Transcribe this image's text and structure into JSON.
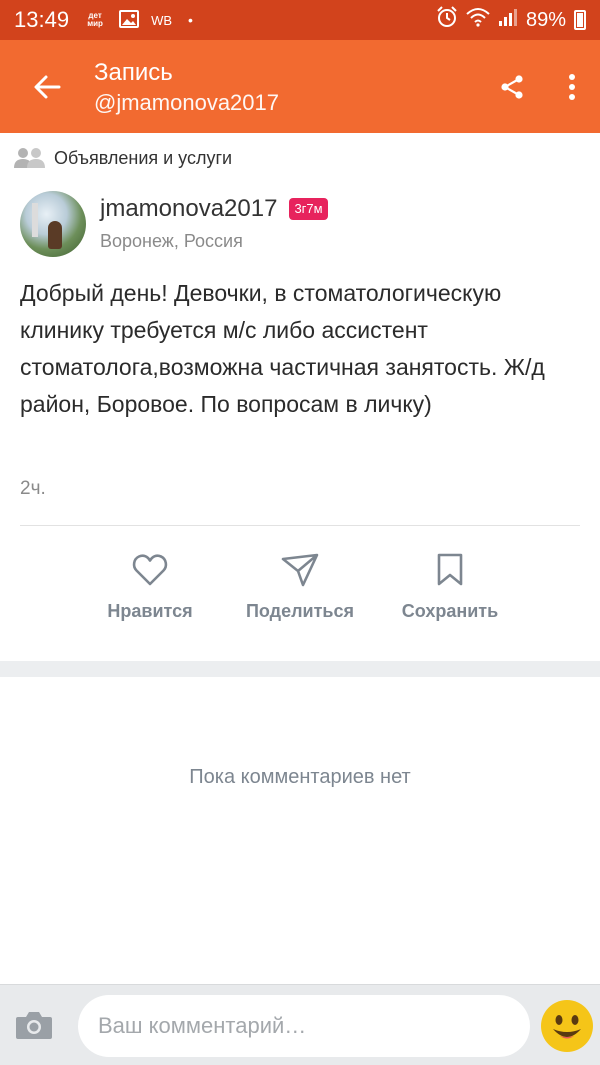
{
  "status_bar": {
    "time": "13:49",
    "notif_detmir": "дет мир",
    "notif_wb": "WB",
    "notif_dot": "•",
    "battery": "89%"
  },
  "app_bar": {
    "title": "Запись",
    "subtitle": "@jmamonova2017"
  },
  "post": {
    "category": "Объявления и услуги",
    "author": {
      "name": "jmamonova2017",
      "age_badge": "3г7м",
      "location": "Воронеж, Россия"
    },
    "text": "Добрый день! Девочки, в стоматологическую клинику требуется м/с либо ассистент стоматолога,возможна частичная занятость. Ж/д район, Боровое. По вопросам в личку)",
    "time": "2ч.",
    "actions": {
      "like": "Нравится",
      "share": "Поделиться",
      "save": "Сохранить"
    }
  },
  "comments": {
    "empty_text": "Пока комментариев нет"
  },
  "comment_bar": {
    "placeholder": "Ваш комментарий…"
  },
  "colors": {
    "status_bar": "#d2431c",
    "app_bar": "#f26a30",
    "badge": "#e7235d",
    "action_gray": "#7d8690",
    "emoji_yellow": "#f5c518"
  }
}
